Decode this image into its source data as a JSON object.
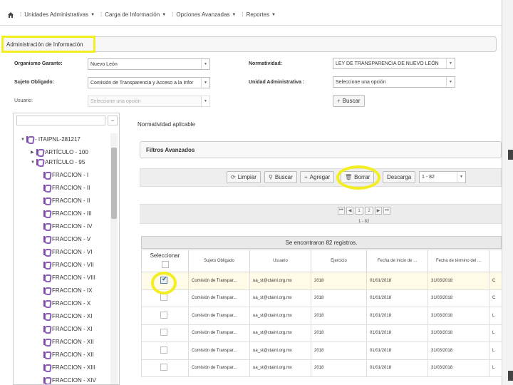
{
  "nav": {
    "items": [
      {
        "label": "Unidades Administrativas"
      },
      {
        "label": "Carga de Información"
      },
      {
        "label": "Opciones Avanzadas"
      },
      {
        "label": "Reportes"
      }
    ]
  },
  "section": {
    "title": "Administración de Información"
  },
  "form": {
    "organismo_label": "Organismo Garante:",
    "organismo_value": "Nuevo León",
    "normatividad_label": "Normatividad:",
    "normatividad_value": "LEY DE TRANSPARENCIA DE NUEVO LEÓN",
    "sujeto_label": "Sujeto Obligado:",
    "sujeto_value": "Comisión de Transparencia y Acceso a la Infor",
    "unidad_label": "Unidad Administrativa :",
    "unidad_value": "Seleccione una opción",
    "usuario_label": "Usuario:",
    "usuario_value": "Seleccione una opción",
    "buscar_label": "Buscar"
  },
  "tree": {
    "collapse_label": "−",
    "root": "- ITAIPNL-281217",
    "articulos": [
      {
        "label": "ARTÍCULO - 100",
        "toggle": "▶"
      },
      {
        "label": "ARTÍCULO - 95",
        "toggle": "▼"
      }
    ],
    "fracciones": [
      "FRACCION - I",
      "FRACCION - II",
      "FRACCION - II",
      "FRACCION - III",
      "FRACCION - IV",
      "FRACCION - V",
      "FRACCION - VI",
      "FRACCION - VII",
      "FRACCION - VIII",
      "FRACCION - IX",
      "FRACCION - X",
      "FRACCION - XI",
      "FRACCION - XI",
      "FRACCION - XII",
      "FRACCION - XII",
      "FRACCION - XIII",
      "FRACCION - XIV"
    ]
  },
  "main": {
    "normatividad_aplicable": "Normatividad aplicable",
    "filtros_title": "Filtros Avanzados",
    "toolbar": {
      "limpiar": "Limpiar",
      "buscar": "Buscar",
      "agregar": "Agregar",
      "borrar": "Borrar",
      "descarga": "Descarga",
      "range": "1 - 82"
    },
    "pager": {
      "pages": [
        "1",
        "2"
      ],
      "info": "1 - 82"
    },
    "results_text": "Se encontraron 82 registros.",
    "columns": [
      "Seleccionar",
      "Sujeto Obligado",
      "Usuario",
      "Ejercicio",
      "Fecha de inicio de ...",
      "Fecha de término del ..."
    ],
    "rows": [
      {
        "checked": true,
        "sujeto": "Comisión de Transpar...",
        "usuario": "ua_st@ctainl.org.mx",
        "ejercicio": "2018",
        "inicio": "01/01/2018",
        "termino": "31/03/2018",
        "extra": "C"
      },
      {
        "checked": false,
        "sujeto": "Comisión de Transpar...",
        "usuario": "ua_st@ctainl.org.mx",
        "ejercicio": "2018",
        "inicio": "01/01/2018",
        "termino": "31/03/2018",
        "extra": "C"
      },
      {
        "checked": false,
        "sujeto": "Comisión de Transpar...",
        "usuario": "ua_st@ctainl.org.mx",
        "ejercicio": "2018",
        "inicio": "01/01/2018",
        "termino": "31/03/2018",
        "extra": "L"
      },
      {
        "checked": false,
        "sujeto": "Comisión de Transpar...",
        "usuario": "ua_st@ctainl.org.mx",
        "ejercicio": "2018",
        "inicio": "01/01/2018",
        "termino": "31/03/2018",
        "extra": "L"
      },
      {
        "checked": false,
        "sujeto": "Comisión de Transpar...",
        "usuario": "ua_st@ctainl.org.mx",
        "ejercicio": "2018",
        "inicio": "01/01/2018",
        "termino": "31/03/2018",
        "extra": "L"
      },
      {
        "checked": false,
        "sujeto": "Comisión de Transpar...",
        "usuario": "ua_st@ctainl.org.mx",
        "ejercicio": "2018",
        "inicio": "01/01/2018",
        "termino": "31/03/2018",
        "extra": "L"
      }
    ]
  },
  "colors": {
    "highlight": "#f2ee20",
    "tree_icon": "#8e5fb8"
  }
}
